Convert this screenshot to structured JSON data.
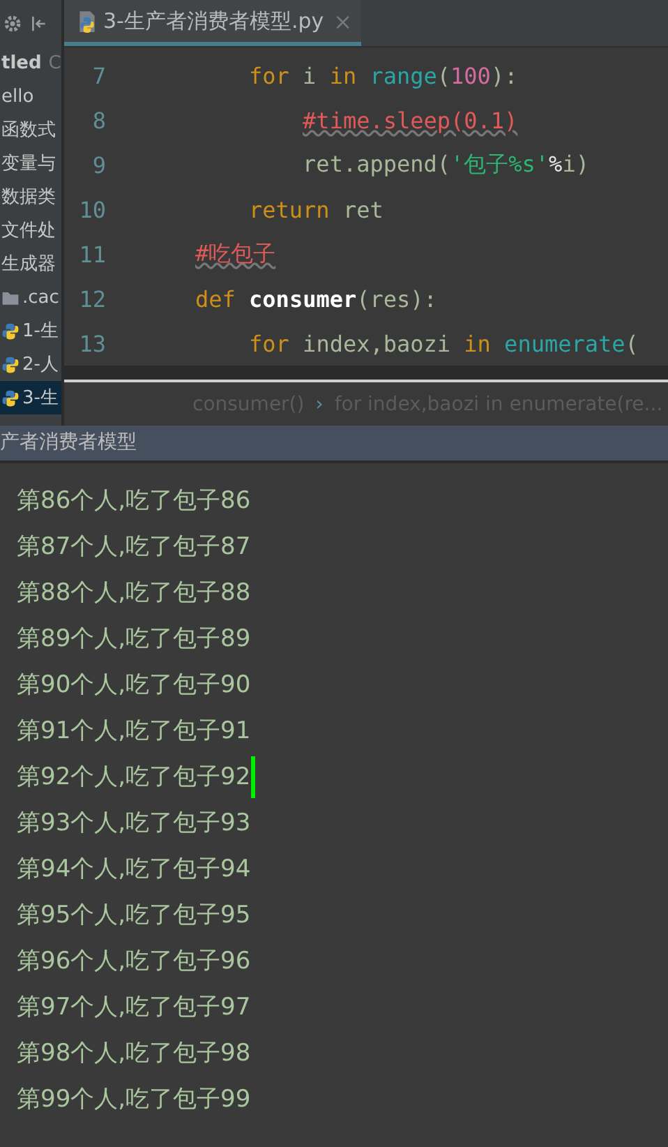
{
  "sidebar": {
    "items": [
      {
        "label": "tled",
        "kind": "project",
        "extra": "C"
      },
      {
        "label": "ello",
        "kind": "text"
      },
      {
        "label": "函数式",
        "kind": "text"
      },
      {
        "label": "变量与",
        "kind": "text"
      },
      {
        "label": "数据类",
        "kind": "text"
      },
      {
        "label": "文件处",
        "kind": "text"
      },
      {
        "label": "生成器",
        "kind": "text"
      },
      {
        "label": ".cac",
        "kind": "folder",
        "selected": false
      },
      {
        "label": "1-生",
        "kind": "python",
        "selected": false
      },
      {
        "label": "2-人",
        "kind": "python",
        "selected": false
      },
      {
        "label": "3-生",
        "kind": "python",
        "selected": true
      }
    ]
  },
  "tabs": [
    {
      "label": "3-生产者消费者模型.py",
      "selected": true,
      "close": "×"
    }
  ],
  "code": {
    "lines": [
      {
        "children": [
          {
            "number": "7",
            "tokens": [
              {
                "text": "for",
                "kind": "keyword"
              },
              {
                "text": " i ",
                "kind": "plain"
              },
              {
                "text": "in",
                "kind": "keyword"
              },
              {
                "text": " range",
                "kind": "builtin"
              },
              {
                "text": "(",
                "kind": "plain"
              },
              {
                "text": "100",
                "kind": "number"
              },
              {
                "text": "):",
                "kind": "plain"
              }
            ],
            "children": [
              {
                "number": "8",
                "tokens": [
                  {
                    "text": "#time.sleep(0.1)",
                    "kind": "comment"
                  }
                ]
              },
              {
                "number": "9",
                "tokens": [
                  {
                    "text": "ret.append(",
                    "kind": "plain"
                  },
                  {
                    "text": "'包子%s'",
                    "kind": "string"
                  },
                  {
                    "text": "%",
                    "kind": "operator"
                  },
                  {
                    "text": "i)",
                    "kind": "plain"
                  }
                ]
              }
            ]
          },
          {
            "number": "10",
            "tokens": [
              {
                "text": "return",
                "kind": "keyword"
              },
              {
                "text": " ret",
                "kind": "plain"
              }
            ]
          }
        ]
      },
      {
        "number": "11",
        "tokens": [
          {
            "text": "#吃包子",
            "kind": "comment"
          }
        ]
      },
      {
        "number": "12",
        "tokens": [
          {
            "text": "def",
            "kind": "keyword"
          },
          {
            "text": " consumer",
            "kind": "function"
          },
          {
            "text": "(res):",
            "kind": "plain"
          }
        ],
        "children": [
          {
            "number": "13",
            "tokens": [
              {
                "text": "for",
                "kind": "keyword"
              },
              {
                "text": " index,baozi ",
                "kind": "plain"
              },
              {
                "text": "in",
                "kind": "keyword"
              },
              {
                "text": " enumerate",
                "kind": "builtin"
              },
              {
                "text": "(",
                "kind": "plain"
              }
            ]
          }
        ]
      }
    ]
  },
  "breadcrumb": [
    "consumer()",
    "for index,baozi in enumerate(re..."
  ],
  "breadcrumb_separator": "›",
  "run_panel": {
    "title": "产者消费者模型",
    "output": [
      {
        "text": "第86个人,吃了包子86",
        "cursor": false
      },
      {
        "text": "第87个人,吃了包子87",
        "cursor": false
      },
      {
        "text": "第88个人,吃了包子88",
        "cursor": false
      },
      {
        "text": "第89个人,吃了包子89",
        "cursor": false
      },
      {
        "text": "第90个人,吃了包子90",
        "cursor": false
      },
      {
        "text": "第91个人,吃了包子91",
        "cursor": false
      },
      {
        "text": "第92个人,吃了包子92",
        "cursor": true
      },
      {
        "text": "第93个人,吃了包子93",
        "cursor": false
      },
      {
        "text": "第94个人,吃了包子94",
        "cursor": false
      },
      {
        "text": "第95个人,吃了包子95",
        "cursor": false
      },
      {
        "text": "第96个人,吃了包子96",
        "cursor": false
      },
      {
        "text": "第97个人,吃了包子97",
        "cursor": false
      },
      {
        "text": "第98个人,吃了包子98",
        "cursor": false
      },
      {
        "text": "第99个人,吃了包子99",
        "cursor": false
      }
    ]
  }
}
